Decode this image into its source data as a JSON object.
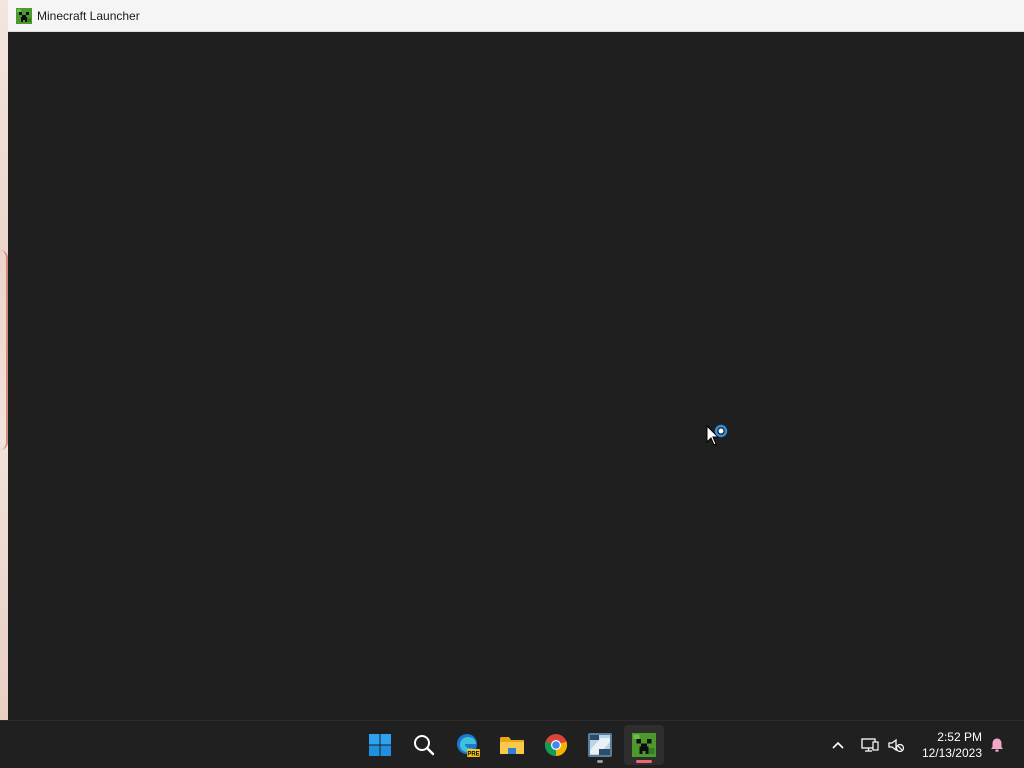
{
  "window": {
    "title": "Minecraft Launcher",
    "icon": "minecraft-creeper-icon"
  },
  "colors": {
    "window_background": "#1f1f1f",
    "titlebar_background": "#f5f5f5",
    "taskbar_background": "#202020",
    "minecraft_green": "#3f8a2a",
    "busy_blue": "#2f8ee0",
    "active_indicator": "#e86b6b",
    "running_indicator": "#9a9a9a"
  },
  "taskbar": {
    "pinned": [
      {
        "name": "start",
        "icon": "windows-start-icon"
      },
      {
        "name": "search",
        "icon": "search-icon"
      },
      {
        "name": "edge-preview",
        "icon": "edge-beta-icon",
        "badge": "PRE"
      },
      {
        "name": "file-explorer",
        "icon": "folder-icon"
      },
      {
        "name": "chrome",
        "icon": "chrome-icon"
      },
      {
        "name": "ccleaner-app",
        "icon": "ccleaner-icon"
      },
      {
        "name": "minecraft-launcher",
        "icon": "minecraft-creeper-icon",
        "active": true
      }
    ],
    "tray": {
      "overflow_icon": "chevron-up-icon",
      "network_icon": "network-icon",
      "volume_icon": "volume-muted-icon",
      "notification_icon": "notification-bell-icon"
    },
    "clock": {
      "time": "2:52 PM",
      "date": "12/13/2023"
    }
  }
}
